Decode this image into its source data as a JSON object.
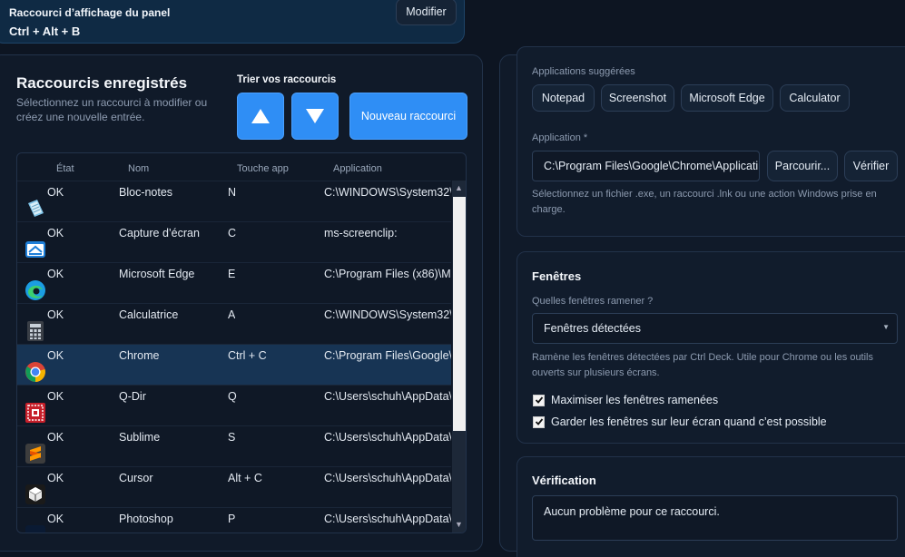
{
  "panel_shortcut": {
    "title": "Raccourci d’affichage du panel",
    "keys": "Ctrl + Alt + B",
    "modify_label": "Modifier"
  },
  "saved": {
    "title": "Raccourcis enregistrés",
    "subtitle": "Sélectionnez un raccourci à modifier ou créez une nouvelle entrée.",
    "sort_title": "Trier vos raccourcis",
    "up_icon": "triangle-up-icon",
    "down_icon": "triangle-down-icon",
    "new_label": "Nouveau raccourci",
    "columns": [
      "État",
      "Nom",
      "Touche app",
      "Application"
    ],
    "rows": [
      {
        "icon": "notepad-icon",
        "state": "OK",
        "name": "Bloc-notes",
        "key": "N",
        "app": "C:\\WINDOWS\\System32\\"
      },
      {
        "icon": "snipping-tool-icon",
        "state": "OK",
        "name": "Capture d’écran",
        "key": "C",
        "app": "ms-screenclip:"
      },
      {
        "icon": "edge-icon",
        "state": "OK",
        "name": "Microsoft Edge",
        "key": "E",
        "app": "C:\\Program Files (x86)\\Mi"
      },
      {
        "icon": "calculator-icon",
        "state": "OK",
        "name": "Calculatrice",
        "key": "A",
        "app": "C:\\WINDOWS\\System32\\"
      },
      {
        "icon": "chrome-icon",
        "state": "OK",
        "name": "Chrome",
        "key": "Ctrl + C",
        "app": "C:\\Program Files\\Google\\"
      },
      {
        "icon": "q-dir-icon",
        "state": "OK",
        "name": "Q-Dir",
        "key": "Q",
        "app": "C:\\Users\\schuh\\AppData\\"
      },
      {
        "icon": "sublime-icon",
        "state": "OK",
        "name": "Sublime",
        "key": "S",
        "app": "C:\\Users\\schuh\\AppData\\"
      },
      {
        "icon": "cursor-icon",
        "state": "OK",
        "name": "Cursor",
        "key": "Alt + C",
        "app": "C:\\Users\\schuh\\AppData\\"
      },
      {
        "icon": "photoshop-icon",
        "state": "OK",
        "name": "Photoshop",
        "key": "P",
        "app": "C:\\Users\\schuh\\AppData\\"
      }
    ],
    "selected_index": 4
  },
  "application_panel": {
    "suggested_label": "Applications suggérées",
    "suggestions": [
      "Notepad",
      "Screenshot",
      "Microsoft Edge",
      "Calculator"
    ],
    "app_label": "Application *",
    "app_value": "C:\\Program Files\\Google\\Chrome\\Applicati",
    "browse_label": "Parcourir...",
    "verify_label": "Vérifier",
    "help": "Sélectionnez un fichier .exe, un raccourci .lnk ou une action Windows prise en charge."
  },
  "windows_panel": {
    "title": "Fenêtres",
    "question": "Quelles fenêtres ramener ?",
    "select_value": "Fenêtres détectées",
    "help": "Ramène les fenêtres détectées par Ctrl Deck. Utile pour Chrome ou les outils ouverts sur plusieurs écrans.",
    "check1": "Maximiser les fenêtres ramenées",
    "check2": "Garder les fenêtres sur leur écran quand c’est possible"
  },
  "verification_panel": {
    "title": "Vérification",
    "message": "Aucun problème pour ce raccourci."
  }
}
